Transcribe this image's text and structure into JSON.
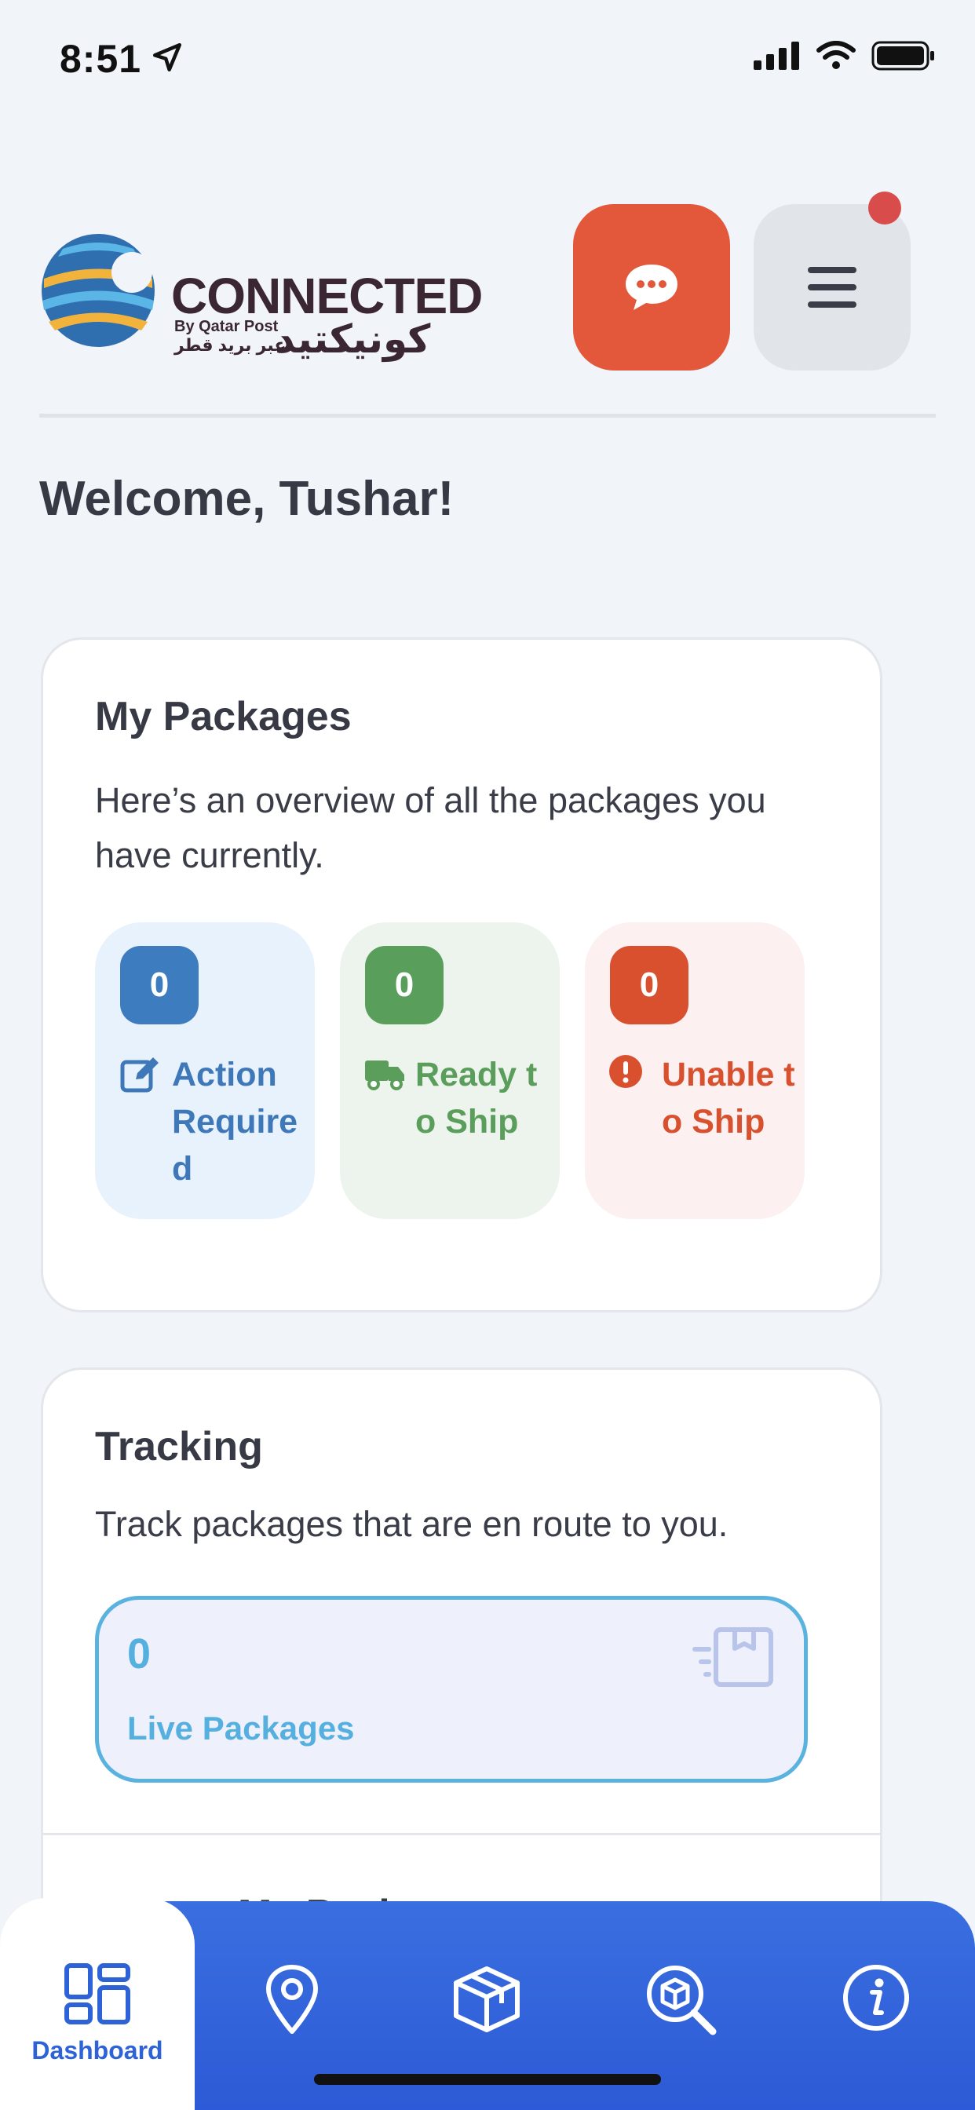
{
  "status_bar": {
    "time": "8:51"
  },
  "header": {
    "logo_word": "CONNECTED",
    "logo_sub": "By Qatar Post",
    "logo_arabic_small": "عبر بريد قطر",
    "logo_arabic_big": "كونيكتيد"
  },
  "welcome": "Welcome, Tushar!",
  "packages": {
    "title": "My Packages",
    "description": "Here’s an overview of all the packages you have currently.",
    "tiles": [
      {
        "count": "0",
        "label": "Action Required",
        "icon": "edit-icon",
        "color": "#3e7cc0"
      },
      {
        "count": "0",
        "label": "Ready to Ship",
        "icon": "truck-icon",
        "color": "#5a9e5c"
      },
      {
        "count": "0",
        "label": "Unable to Ship",
        "icon": "alert-icon",
        "color": "#d9502e"
      }
    ]
  },
  "tracking": {
    "title": "Tracking",
    "description": "Track packages that are en route to you.",
    "live_count": "0",
    "live_label": "Live Packages",
    "next_section_peek": "Locate My Package"
  },
  "bottom_nav": {
    "items": [
      {
        "label": "Dashboard",
        "icon": "dashboard-icon",
        "active": true
      },
      {
        "label": "",
        "icon": "location-pin-icon"
      },
      {
        "label": "",
        "icon": "package-box-icon"
      },
      {
        "label": "",
        "icon": "package-search-icon"
      },
      {
        "label": "",
        "icon": "info-icon"
      }
    ]
  },
  "colors": {
    "accent_orange": "#e3573a",
    "nav_blue": "#2d5ad6",
    "live_blue": "#55b0e0"
  }
}
